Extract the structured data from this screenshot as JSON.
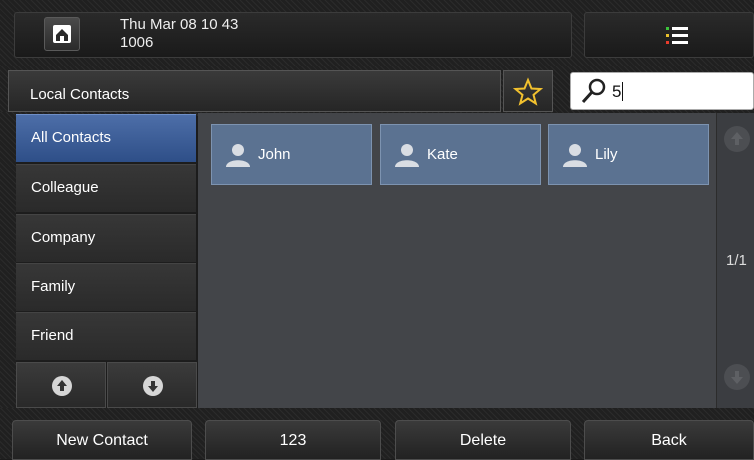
{
  "status_bar": {
    "datetime": "Thu Mar 08 10 43",
    "extension": "1006"
  },
  "header": {
    "title": "Local Contacts"
  },
  "search": {
    "value": "5"
  },
  "sidebar": {
    "items": [
      {
        "label": "All Contacts",
        "active": true
      },
      {
        "label": "Colleague"
      },
      {
        "label": "Company"
      },
      {
        "label": "Family"
      },
      {
        "label": "Friend"
      }
    ]
  },
  "contacts": [
    {
      "name": "John"
    },
    {
      "name": "Kate"
    },
    {
      "name": "Lily"
    }
  ],
  "pagination": {
    "text": "1/1"
  },
  "softkeys": [
    {
      "label": "New Contact"
    },
    {
      "label": "123"
    },
    {
      "label": "Delete"
    },
    {
      "label": "Back"
    }
  ],
  "colors": {
    "accent": "#3a5c98",
    "contact_tile": "#5b7291",
    "menu_dots": [
      "#e83c2c",
      "#e8c02c",
      "#3cc43c"
    ]
  },
  "icons": [
    "home-icon",
    "menu-list-icon",
    "star-icon",
    "search-icon",
    "person-icon",
    "arrow-up-icon",
    "arrow-down-icon"
  ]
}
